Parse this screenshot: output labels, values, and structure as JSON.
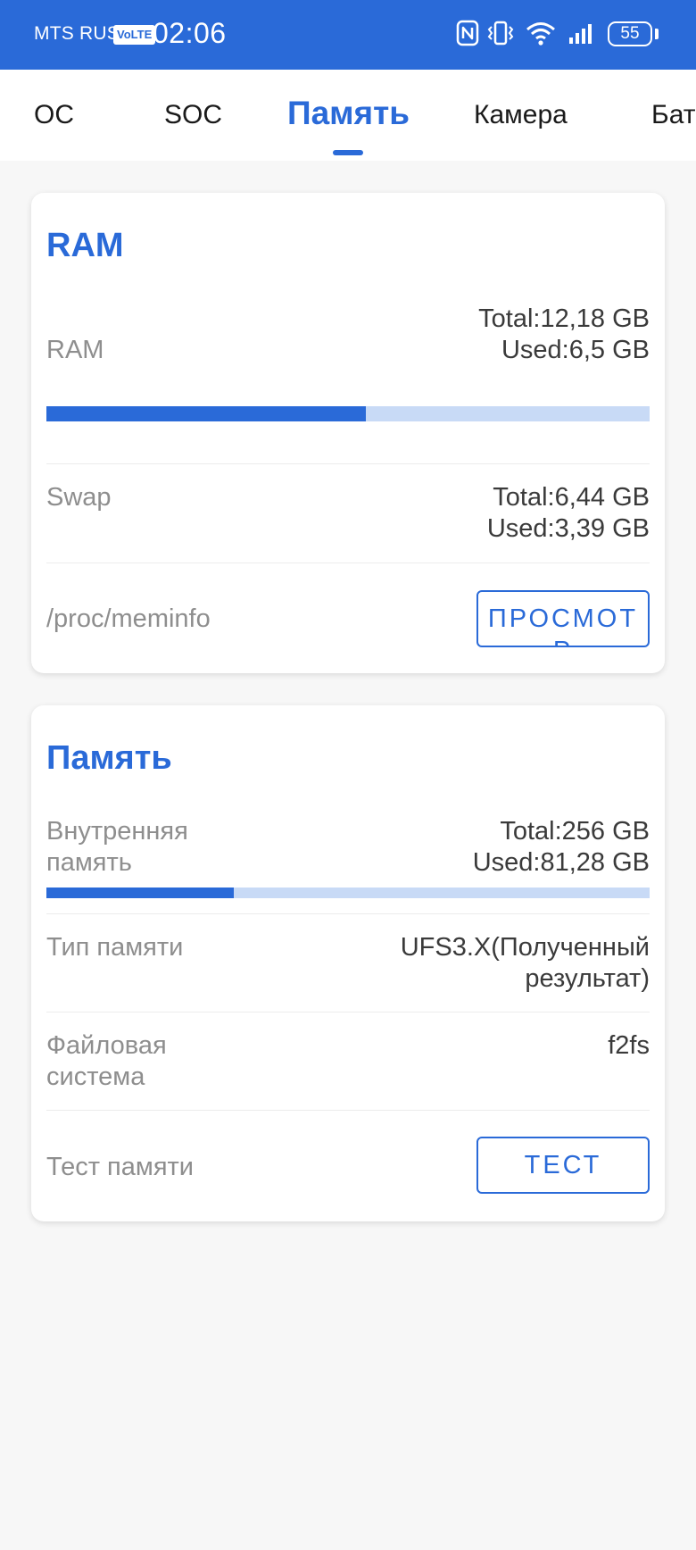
{
  "status_bar": {
    "carrier": "MTS RUS",
    "volte": "VoLTE",
    "time": "02:06",
    "battery": "55"
  },
  "tabs": [
    {
      "label": "ОС"
    },
    {
      "label": "SOC"
    },
    {
      "label": "Память",
      "active": true
    },
    {
      "label": "Камера"
    },
    {
      "label": "Бат"
    }
  ],
  "ram_card": {
    "title": "RAM",
    "ram": {
      "label": "RAM",
      "total": "Total:12,18 GB",
      "used": "Used:6,5 GB",
      "used_fraction": 0.53
    },
    "swap": {
      "label": "Swap",
      "total": "Total:6,44 GB",
      "used": "Used:3,39 GB"
    },
    "meminfo": {
      "label": "/proc/meminfo",
      "button": "ПРОСМОТР"
    }
  },
  "storage_card": {
    "title": "Память",
    "internal": {
      "label_line1": "Внутренняя",
      "label_line2": "память",
      "total": "Total:256 GB",
      "used": "Used:81,28 GB",
      "used_fraction": 0.31
    },
    "memory_type": {
      "label": "Тип памяти",
      "value_line1": "UFS3.X(Полученный",
      "value_line2": "результат)"
    },
    "filesystem": {
      "label_line1": "Файловая",
      "label_line2": "система",
      "value": "f2fs"
    },
    "memory_test": {
      "label": "Тест памяти",
      "button": "ТЕСТ"
    }
  },
  "colors": {
    "accent": "#2a6ad8",
    "progress_track": "#c8daf6",
    "background": "#f7f7f7"
  }
}
